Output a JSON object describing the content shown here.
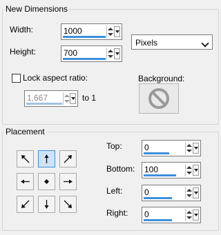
{
  "new_dimensions": {
    "title": "New Dimensions",
    "width_label": "Width:",
    "width_value": "1000",
    "height_label": "Height:",
    "height_value": "700",
    "units_selected": "Pixels",
    "lock_aspect_label": "Lock aspect ratio:",
    "lock_aspect_checked": false,
    "aspect_value": "1,667",
    "aspect_suffix": "to 1",
    "background_label": "Background:"
  },
  "placement": {
    "title": "Placement",
    "anchors": [
      {
        "icon": "arrow-up-left-icon"
      },
      {
        "icon": "arrow-up-icon",
        "selected": true
      },
      {
        "icon": "arrow-up-right-icon"
      },
      {
        "icon": "arrow-left-icon"
      },
      {
        "icon": "center-dot-icon"
      },
      {
        "icon": "arrow-right-icon"
      },
      {
        "icon": "arrow-down-left-icon"
      },
      {
        "icon": "arrow-down-icon"
      },
      {
        "icon": "arrow-down-right-icon"
      }
    ],
    "top_label": "Top:",
    "top_value": "0",
    "bottom_label": "Bottom:",
    "bottom_value": "100",
    "left_label": "Left:",
    "left_value": "0",
    "right_label": "Right:",
    "right_value": "0"
  },
  "colors": {
    "accent": "#3c8fdb",
    "selected_anchor": "#cfe3f7"
  }
}
